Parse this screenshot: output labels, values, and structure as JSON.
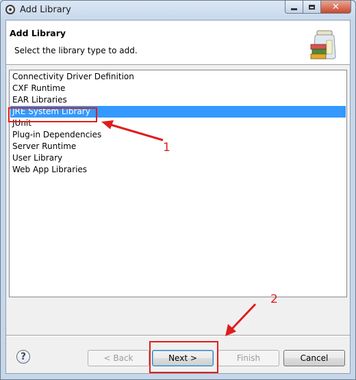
{
  "window": {
    "title": "Add Library"
  },
  "header": {
    "title": "Add Library",
    "description": "Select the library type to add."
  },
  "library_types": [
    "Connectivity Driver Definition",
    "CXF Runtime",
    "EAR Libraries",
    "JRE System Library",
    "JUnit",
    "Plug-in Dependencies",
    "Server Runtime",
    "User Library",
    "Web App Libraries"
  ],
  "selected_library": "JRE System Library",
  "buttons": {
    "back": "< Back",
    "next": "Next >",
    "finish": "Finish",
    "cancel": "Cancel",
    "help": "?"
  },
  "annotations": {
    "step1": "1",
    "step2": "2"
  },
  "colors": {
    "selection": "#3399ff",
    "annotation": "#e01c1c"
  },
  "icons": {
    "app": "eclipse-icon",
    "header": "library-jar-icon",
    "help": "help-icon"
  }
}
